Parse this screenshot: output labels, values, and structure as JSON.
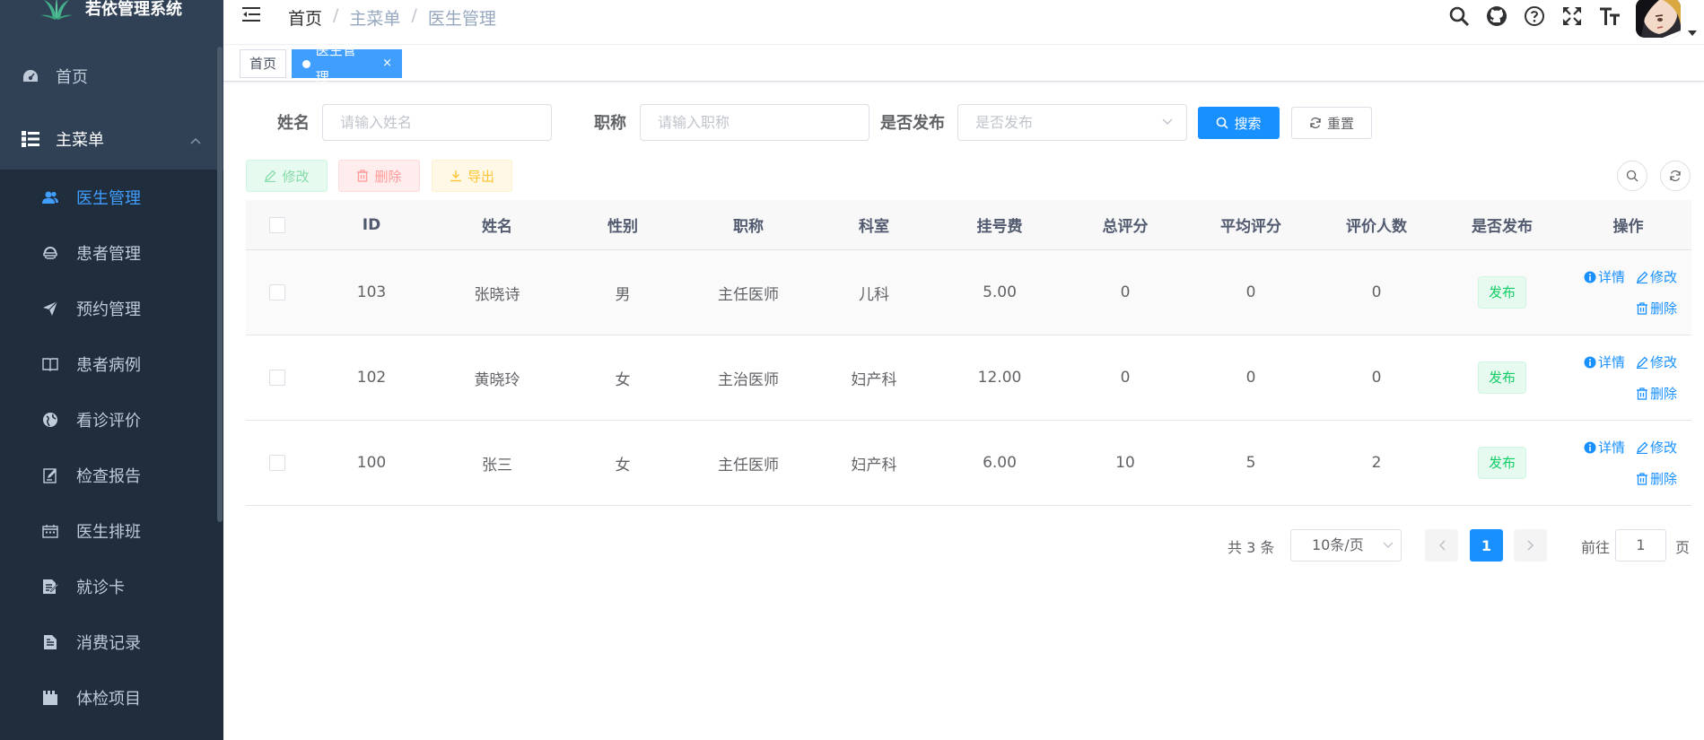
{
  "app": {
    "title": "若依管理系统"
  },
  "sidebar": {
    "home": "首页",
    "main_menu": "主菜单",
    "items": [
      {
        "label": "医生管理",
        "icon": "peoples-icon",
        "active": true
      },
      {
        "label": "患者管理",
        "icon": "user-icon"
      },
      {
        "label": "预约管理",
        "icon": "paper-plane-icon"
      },
      {
        "label": "患者病例",
        "icon": "book-icon"
      },
      {
        "label": "看诊评价",
        "icon": "globe-icon"
      },
      {
        "label": "检查报告",
        "icon": "edit-doc-icon"
      },
      {
        "label": "医生排班",
        "icon": "calendar-icon"
      },
      {
        "label": "就诊卡",
        "icon": "card-icon"
      },
      {
        "label": "消费记录",
        "icon": "document-icon"
      },
      {
        "label": "体检项目",
        "icon": "clapper-icon"
      }
    ]
  },
  "breadcrumb": {
    "items": [
      "首页",
      "主菜单",
      "医生管理"
    ],
    "separator": "/"
  },
  "tags": {
    "home": "首页",
    "active": "医生管理",
    "close": "×"
  },
  "search": {
    "name_label": "姓名",
    "name_placeholder": "请输入姓名",
    "title_label": "职称",
    "title_placeholder": "请输入职称",
    "publish_label": "是否发布",
    "publish_placeholder": "是否发布",
    "search_btn": "搜索",
    "reset_btn": "重置"
  },
  "toolbar": {
    "edit": "修改",
    "delete": "删除",
    "export": "导出"
  },
  "table": {
    "headers": [
      "ID",
      "姓名",
      "性别",
      "职称",
      "科室",
      "挂号费",
      "总评分",
      "平均评分",
      "评价人数",
      "是否发布",
      "操作"
    ],
    "rows": [
      {
        "id": "103",
        "name": "张晓诗",
        "sex": "男",
        "title": "主任医师",
        "dept": "儿科",
        "fee": "5.00",
        "total": "0",
        "avg": "0",
        "count": "0",
        "publish": "发布"
      },
      {
        "id": "102",
        "name": "黄晓玲",
        "sex": "女",
        "title": "主治医师",
        "dept": "妇产科",
        "fee": "12.00",
        "total": "0",
        "avg": "0",
        "count": "0",
        "publish": "发布"
      },
      {
        "id": "100",
        "name": "张三",
        "sex": "女",
        "title": "主任医师",
        "dept": "妇产科",
        "fee": "6.00",
        "total": "10",
        "avg": "5",
        "count": "2",
        "publish": "发布"
      }
    ],
    "ops": {
      "detail": "详情",
      "edit": "修改",
      "delete": "删除"
    }
  },
  "pagination": {
    "total": "共 3 条",
    "page_size": "10条/页",
    "current": "1",
    "goto_prefix": "前往",
    "goto_value": "1",
    "goto_suffix": "页"
  },
  "colors": {
    "sidebar": "#304156",
    "submenu": "#1f2d3d",
    "primary": "#1890ff",
    "success": "#13ce66"
  }
}
